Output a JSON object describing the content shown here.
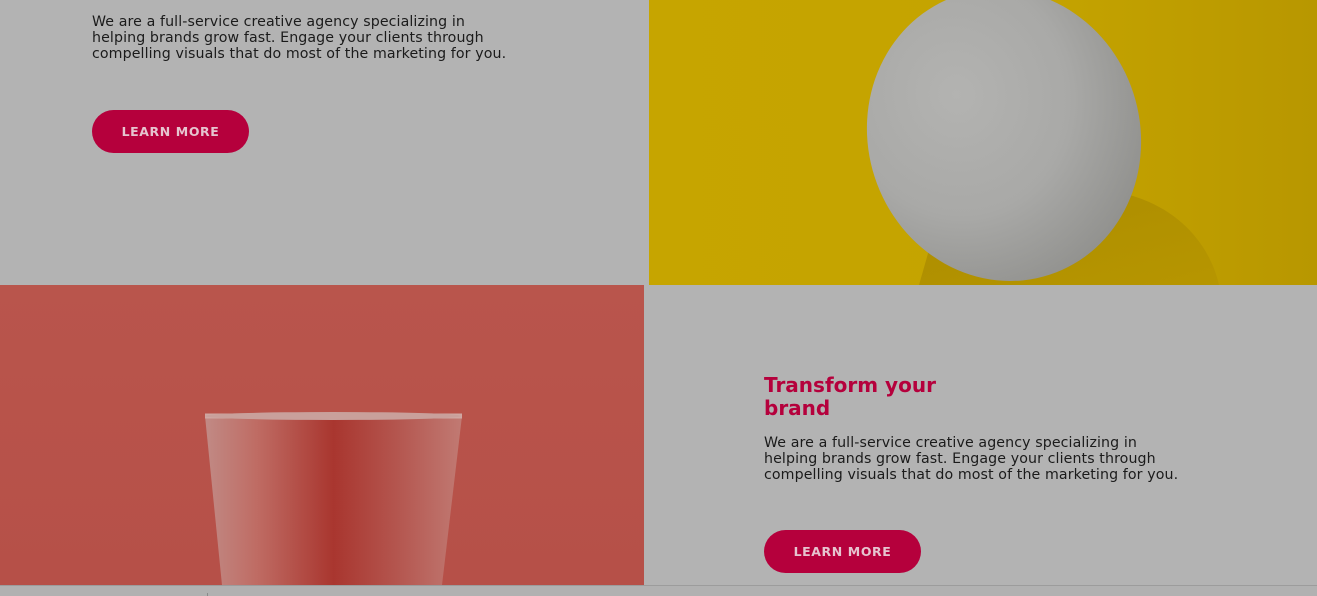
{
  "feature_top": {
    "description": "We are a full-service creative agency specializing in helping brands grow fast. Engage your clients through compelling visuals that do most of the marketing for you.",
    "button_label": "LEARN MORE"
  },
  "feature_bottom": {
    "heading": "Transform your brand",
    "description": "We are a full-service creative agency specializing in helping brands grow fast. Engage your clients through compelling visuals that do most of the marketing for you.",
    "button_label": "LEARN MORE"
  },
  "images": {
    "top_right": "egg-photo",
    "bottom_left": "cup-photo"
  },
  "colors": {
    "accent": "#b5003c",
    "overlay_gray": "#b3b3b3",
    "egg_background": "#c4a300",
    "cup_background": "#b8534a"
  }
}
